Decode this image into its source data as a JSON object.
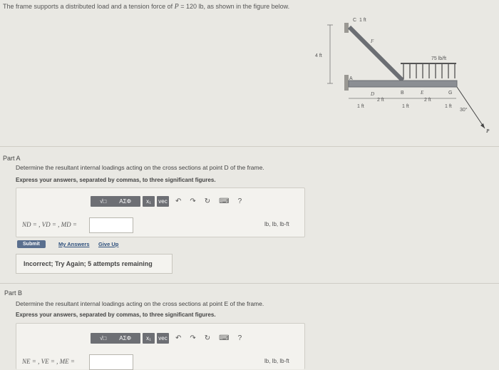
{
  "problem": {
    "prefix": "The frame supports a distributed load and a tension force of",
    "force_symbol": "P",
    "force_value": " = 120 lb",
    "suffix": ", as shown in the figure below."
  },
  "figure": {
    "dim_1ft_top": "1 ft",
    "label_c": "C",
    "label_f": "F",
    "dim_4ft": "4 ft",
    "load_label": "75 lb/ft",
    "label_a": "A",
    "label_d": "D",
    "label_b": "B",
    "label_e": "E",
    "label_g": "G",
    "dim_2ft_a": "2 ft",
    "dim_2ft_b": "2 ft",
    "dim_1ft_a": "1 ft",
    "dim_1ft_b": "1 ft",
    "dim_1ft_c": "1 ft",
    "angle": "30°",
    "label_p": "P"
  },
  "partA": {
    "heading": "Part A",
    "question": "Determine the resultant internal loadings acting on the cross sections at point D of the frame.",
    "instruction": "Express your answers, separated by commas, to three significant figures.",
    "label": "ND = , VD = , MD =",
    "units": "lb, lb, lb-ft",
    "submit": "Submit",
    "my_answers": "My Answers",
    "give_up": "Give Up",
    "feedback": "Incorrect; Try Again; 5 attempts remaining"
  },
  "partB": {
    "heading": "Part B",
    "question": "Determine the resultant internal loadings acting on the cross sections at point E of the frame.",
    "instruction": "Express your answers, separated by commas, to three significant figures.",
    "label": "NE = , VE = , ME =",
    "units": "lb, lb, lb-ft"
  },
  "toolbar": {
    "templates": "√□",
    "symbols": "ΑΣΦ",
    "subscript": "x₁",
    "vec": "vec",
    "undo_icon": "↶",
    "redo_icon": "↷",
    "reset_icon": "↻",
    "keyboard_icon": "⌨",
    "help": "?"
  }
}
